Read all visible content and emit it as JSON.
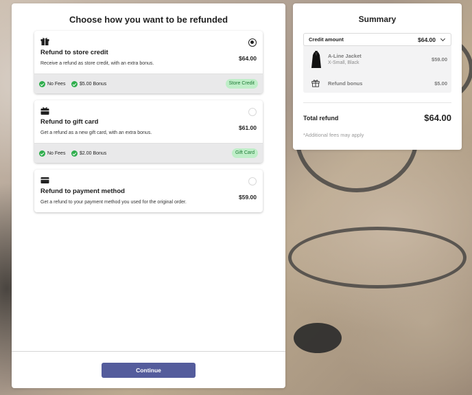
{
  "main": {
    "title": "Choose how you want to be refunded",
    "options": [
      {
        "icon": "gift-icon",
        "title": "Refund to store credit",
        "description": "Receive a refund as store credit, with an extra bonus.",
        "price": "$64.00",
        "selected": true,
        "features": [
          "No Fees",
          "$5.00 Bonus"
        ],
        "tag": "Store Credit"
      },
      {
        "icon": "gift-card-icon",
        "title": "Refund to gift card",
        "description": "Get a refund as a new gift card, with an extra bonus.",
        "price": "$61.00",
        "selected": false,
        "features": [
          "No Fees",
          "$2.00 Bonus"
        ],
        "tag": "Gift Card"
      },
      {
        "icon": "credit-card-icon",
        "title": "Refund to payment method",
        "description": "Get a refund to your payment method you used for the original order.",
        "price": "$59.00",
        "selected": false
      }
    ],
    "continue_label": "Continue"
  },
  "summary": {
    "title": "Summary",
    "credit_label": "Credit amount",
    "credit_value": "$64.00",
    "item_name": "A-Line Jacket",
    "item_variant": "X-Small, Black",
    "item_price": "$59.00",
    "bonus_label": "Refund bonus",
    "bonus_value": "$5.00",
    "total_label": "Total refund",
    "total_value": "$64.00",
    "fees_note": "*Additional fees may apply"
  },
  "colors": {
    "accent": "#545c9c",
    "tag_bg": "#bfeec8",
    "tag_text": "#1e7a35",
    "check": "#2fae4d"
  }
}
